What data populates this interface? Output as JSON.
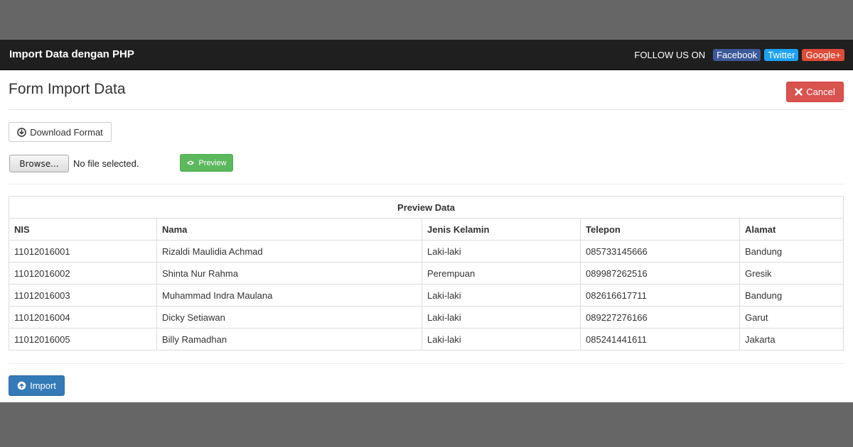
{
  "navbar": {
    "brand": "Import Data dengan PHP",
    "follow_text": "FOLLOW US ON",
    "social": [
      {
        "label": "Facebook",
        "color": "#3b5998"
      },
      {
        "label": "Twitter",
        "color": "#1da1f2"
      },
      {
        "label": "Google+",
        "color": "#dd4b39"
      }
    ]
  },
  "page": {
    "title": "Form Import Data",
    "cancel_label": "Cancel",
    "cancel_icon": "remove-icon",
    "download_label": "Download Format",
    "download_icon": "download-icon",
    "browse_label": "Browse...",
    "file_status": "No file selected.",
    "preview_label": "Preview",
    "preview_icon": "eye-icon",
    "import_label": "Import",
    "import_icon": "upload-icon"
  },
  "table": {
    "caption": "Preview Data",
    "headers": [
      "NIS",
      "Nama",
      "Jenis Kelamin",
      "Telepon",
      "Alamat"
    ],
    "rows": [
      [
        "11012016001",
        "Rizaldi Maulidia Achmad",
        "Laki-laki",
        "085733145666",
        "Bandung"
      ],
      [
        "11012016002",
        "Shinta Nur Rahma",
        "Perempuan",
        "089987262516",
        "Gresik"
      ],
      [
        "11012016003",
        "Muhammad Indra Maulana",
        "Laki-laki",
        "082616617711",
        "Bandung"
      ],
      [
        "11012016004",
        "Dicky Setiawan",
        "Laki-laki",
        "089227276166",
        "Garut"
      ],
      [
        "11012016005",
        "Billy Ramadhan",
        "Laki-laki",
        "085241441611",
        "Jakarta"
      ]
    ]
  },
  "colors": {
    "danger": "#d9534f",
    "success": "#5cb85c",
    "primary": "#337ab7",
    "navbar": "#1f1f1f"
  }
}
